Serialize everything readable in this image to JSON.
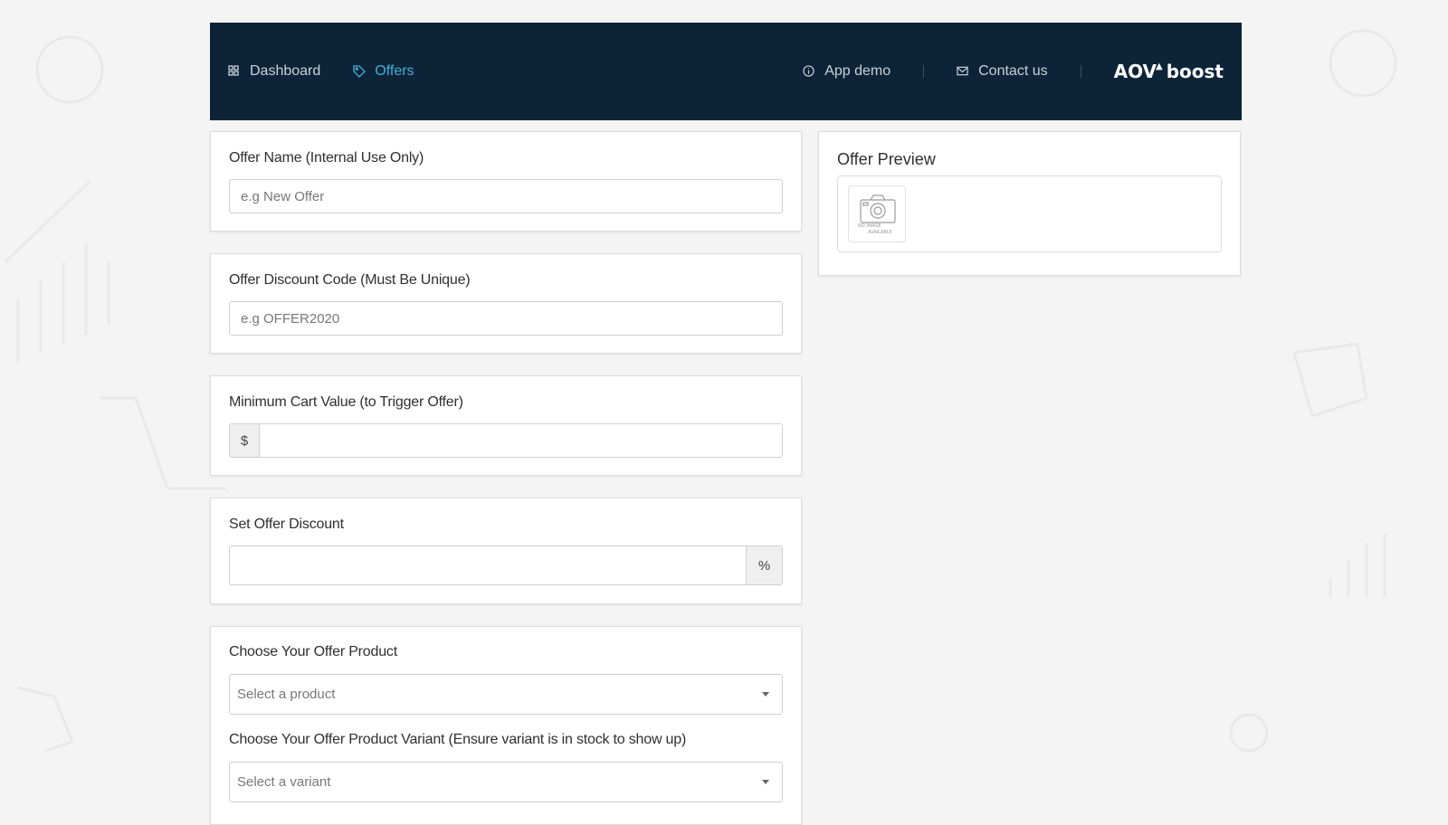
{
  "nav": {
    "items": [
      {
        "label": "Dashboard",
        "icon": "grid-icon",
        "active": false
      },
      {
        "label": "Offers",
        "icon": "tag-icon",
        "active": true
      }
    ],
    "right_items": [
      {
        "label": "App demo",
        "icon": "info-circle-icon"
      },
      {
        "label": "Contact us",
        "icon": "envelope-icon"
      }
    ],
    "logo": {
      "text_a": "AOV",
      "text_b": "boost"
    },
    "colors": {
      "background": "#0d2438",
      "active": "#3fb0d9",
      "text": "#c9d1d9"
    }
  },
  "form": {
    "offer_name": {
      "label": "Offer Name (Internal Use Only)",
      "placeholder": "e.g New Offer",
      "value": ""
    },
    "discount_code": {
      "label": "Offer Discount Code (Must Be Unique)",
      "placeholder": "e.g OFFER2020",
      "value": ""
    },
    "min_cart": {
      "label": "Minimum Cart Value (to Trigger Offer)",
      "prefix": "$",
      "value": ""
    },
    "discount": {
      "label": "Set Offer Discount",
      "suffix": "%",
      "value": ""
    },
    "product": {
      "label": "Choose Your Offer Product",
      "placeholder": "Select a product",
      "variant_label": "Choose Your Offer Product Variant (Ensure variant is in stock to show up)",
      "variant_placeholder": "Select a variant"
    }
  },
  "preview": {
    "title": "Offer Preview",
    "thumb_text_1": "NO IMAGE",
    "thumb_text_2": "AVAILABLE"
  }
}
